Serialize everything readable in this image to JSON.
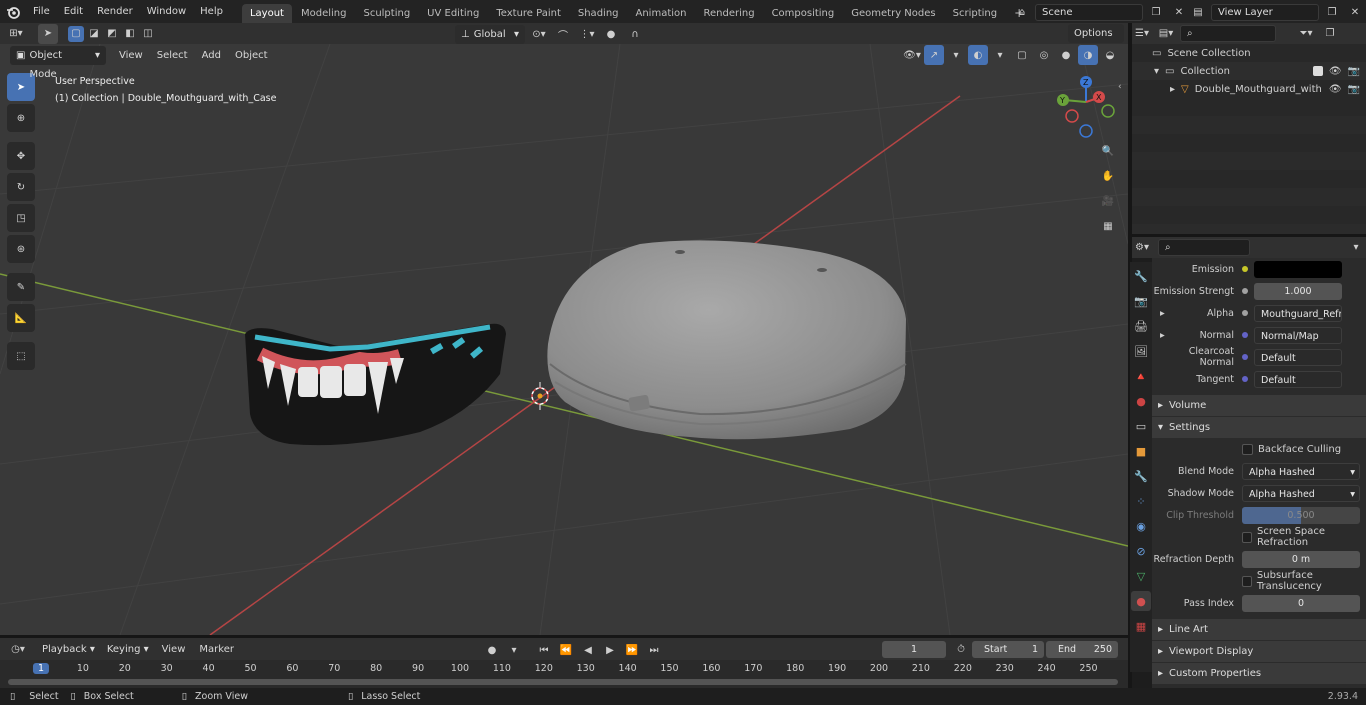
{
  "menus": [
    "File",
    "Edit",
    "Render",
    "Window",
    "Help"
  ],
  "workspaces": [
    "Layout",
    "Modeling",
    "Sculpting",
    "UV Editing",
    "Texture Paint",
    "Shading",
    "Animation",
    "Rendering",
    "Compositing",
    "Geometry Nodes",
    "Scripting"
  ],
  "scene_name": "Scene",
  "view_layer": "View Layer",
  "viewport": {
    "mode": "Object Mode",
    "menus": [
      "View",
      "Select",
      "Add",
      "Object"
    ],
    "transform_orientation": "Global",
    "options_label": "Options",
    "overlay_title": "User Perspective",
    "overlay_subtitle": "(1) Collection | Double_Mouthguard_with_Case",
    "gizmo_labels": {
      "z": "Z",
      "y": "Y",
      "x": "X"
    }
  },
  "outliner": {
    "scene_collection": "Scene Collection",
    "collection": "Collection",
    "object": "Double_Mouthguard_with"
  },
  "properties": {
    "rows_top": [
      {
        "label": "Emission",
        "value": "",
        "socket_color": "#c7c729",
        "type": "color"
      },
      {
        "label": "Emission Strengt",
        "value": "1.000",
        "socket_color": "#a1a1a1",
        "type": "number"
      },
      {
        "label": "Alpha",
        "value": "Mouthguard_Refract...",
        "socket_color": "#a1a1a1",
        "type": "link",
        "expand": true
      },
      {
        "label": "Normal",
        "value": "Normal/Map",
        "socket_color": "#6363c7",
        "type": "link",
        "expand": true
      },
      {
        "label": "Clearcoat Normal",
        "value": "Default",
        "socket_color": "#6363c7",
        "type": "link"
      },
      {
        "label": "Tangent",
        "value": "Default",
        "socket_color": "#6363c7",
        "type": "link"
      }
    ],
    "panel_volume": "Volume",
    "panel_settings": "Settings",
    "backface_culling": "Backface Culling",
    "blend_mode_label": "Blend Mode",
    "blend_mode": "Alpha Hashed",
    "shadow_mode_label": "Shadow Mode",
    "shadow_mode": "Alpha Hashed",
    "clip_threshold_label": "Clip Threshold",
    "clip_threshold": "0.500",
    "ssr": "Screen Space Refraction",
    "refraction_depth_label": "Refraction Depth",
    "refraction_depth": "0 m",
    "subsurface": "Subsurface Translucency",
    "pass_index_label": "Pass Index",
    "pass_index": "0",
    "panel_line_art": "Line Art",
    "panel_viewport_display": "Viewport Display",
    "panel_custom_properties": "Custom Properties"
  },
  "timeline": {
    "menus": [
      "Playback",
      "Keying",
      "View",
      "Marker"
    ],
    "current_frame": "1",
    "start_label": "Start",
    "start": "1",
    "end_label": "End",
    "end": "250",
    "ruler": [
      "1",
      "10",
      "20",
      "30",
      "40",
      "50",
      "60",
      "70",
      "80",
      "90",
      "100",
      "110",
      "120",
      "130",
      "140",
      "150",
      "160",
      "170",
      "180",
      "190",
      "200",
      "210",
      "220",
      "230",
      "240",
      "250"
    ]
  },
  "status": {
    "select": "Select",
    "box_select": "Box Select",
    "zoom_view": "Zoom View",
    "lasso_select": "Lasso Select",
    "version": "2.93.4"
  }
}
